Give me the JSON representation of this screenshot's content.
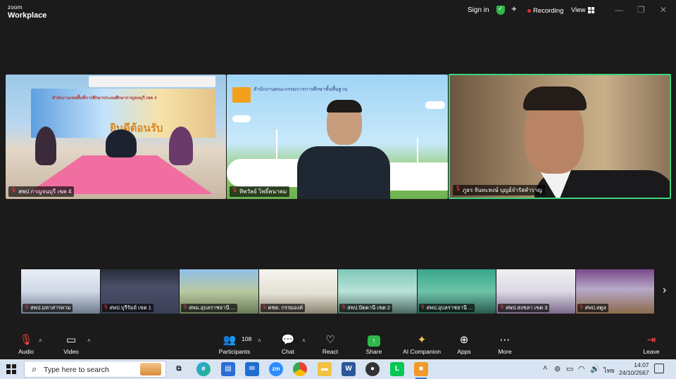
{
  "titlebar": {
    "logo_top": "zoom",
    "logo_bottom": "Workplace",
    "signin": "Sign in",
    "recording": "Recording",
    "view": "View",
    "icons": [
      "shield-check-icon",
      "sparkle-icon",
      "grid-icon",
      "minimize-icon",
      "maximize-icon",
      "close-icon"
    ]
  },
  "main_tiles": [
    {
      "name": "สพป.กาญจนบุรี เขต 4",
      "muted": true,
      "banner_small": "สำนักงานเขตพื้นที่การศึกษาประถมศึกษากาญจนบุรี เขต 4",
      "banner_big": "ยินดีต้อนรับ"
    },
    {
      "name": "ทิพวัลย์ โพธิ์คนาคม",
      "muted": true,
      "title": "สำนักงานคณะกรรมการการศึกษาขั้นพื้นฐาน"
    },
    {
      "name": "ภูธร จันทะหงษ์ บุญย์จำรัสสำราญ",
      "muted": true,
      "active_speaker": true
    }
  ],
  "thumbnails": [
    {
      "name": "สพป.มหาสารคาม",
      "muted": true
    },
    {
      "name": "สพป.บุรีรัมย์ เขต 1",
      "muted": true
    },
    {
      "name": "สพม.อุบลราชธานี ...",
      "muted": true
    },
    {
      "name": "ตชด. กรรมองค์",
      "muted": true
    },
    {
      "name": "สพป.ปัตตานี เขต 2",
      "muted": true
    },
    {
      "name": "สพป.อุบลราชธานี ...",
      "muted": true
    },
    {
      "name": "สพป.สงขลา เขต 3",
      "muted": true
    },
    {
      "name": "สพป.สตูล",
      "muted": true
    }
  ],
  "toolbar": {
    "audio": "Audio",
    "video": "Video",
    "participants": "Participants",
    "participants_count": "108",
    "chat": "Chat",
    "react": "React",
    "share": "Share",
    "ai_companion": "AI Companion",
    "apps": "Apps",
    "more": "More",
    "leave": "Leave"
  },
  "taskbar": {
    "search_placeholder": "Type here to search",
    "lang": "ไทย",
    "time": "14:07",
    "date": "24/10/2567",
    "apps": [
      "task-view",
      "edge",
      "store",
      "mail",
      "zoom",
      "chrome",
      "explorer",
      "word",
      "record",
      "line",
      "app-orange"
    ]
  },
  "colors": {
    "bg": "#1b1b1b",
    "active_speaker_border": "#3fd27a",
    "recording_dot": "#e02f2f",
    "share": "#2fb84a",
    "muted": "#ff3b3b"
  }
}
